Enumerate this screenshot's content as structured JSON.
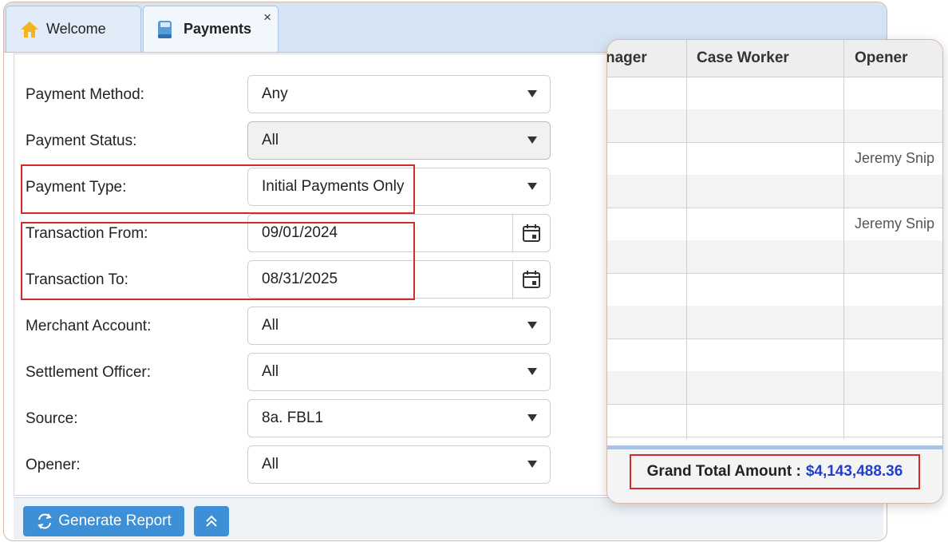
{
  "tabs": {
    "welcome": "Welcome",
    "payments": "Payments",
    "close": "×"
  },
  "form": {
    "payment_method": {
      "label": "Payment Method:",
      "value": "Any"
    },
    "payment_status": {
      "label": "Payment Status:",
      "value": "All"
    },
    "payment_type": {
      "label": "Payment Type:",
      "value": "Initial Payments Only"
    },
    "transaction_from": {
      "label": "Transaction From:",
      "value": "09/01/2024"
    },
    "transaction_to": {
      "label": "Transaction To:",
      "value": "08/31/2025"
    },
    "merchant_account": {
      "label": "Merchant Account:",
      "value": "All"
    },
    "settlement_officer": {
      "label": "Settlement Officer:",
      "value": "All"
    },
    "source": {
      "label": "Source:",
      "value": "8a. FBL1"
    },
    "opener": {
      "label": "Opener:",
      "value": "All"
    }
  },
  "toolbar": {
    "generate_label": "Generate Report"
  },
  "results": {
    "columns": [
      "nager",
      "Case Worker",
      "Opener"
    ],
    "rows": [
      {
        "opener": ""
      },
      {
        "opener": ""
      },
      {
        "opener": "Jeremy Snip"
      },
      {
        "opener": ""
      },
      {
        "opener": "Jeremy Snip"
      },
      {
        "opener": ""
      },
      {
        "opener": ""
      },
      {
        "opener": ""
      },
      {
        "opener": ""
      },
      {
        "opener": ""
      },
      {
        "opener": ""
      }
    ],
    "grand_total_label": "Grand Total Amount :",
    "grand_total_value": "$4,143,488.36"
  },
  "colors": {
    "accent": "#3d8fd6",
    "highlight": "#d42a2a",
    "total_value": "#1f3fd1"
  },
  "icons": [
    "home-icon",
    "book-icon",
    "close-icon",
    "calendar-icon",
    "refresh-icon",
    "double-chevron-up-icon",
    "chevron-down-icon"
  ]
}
